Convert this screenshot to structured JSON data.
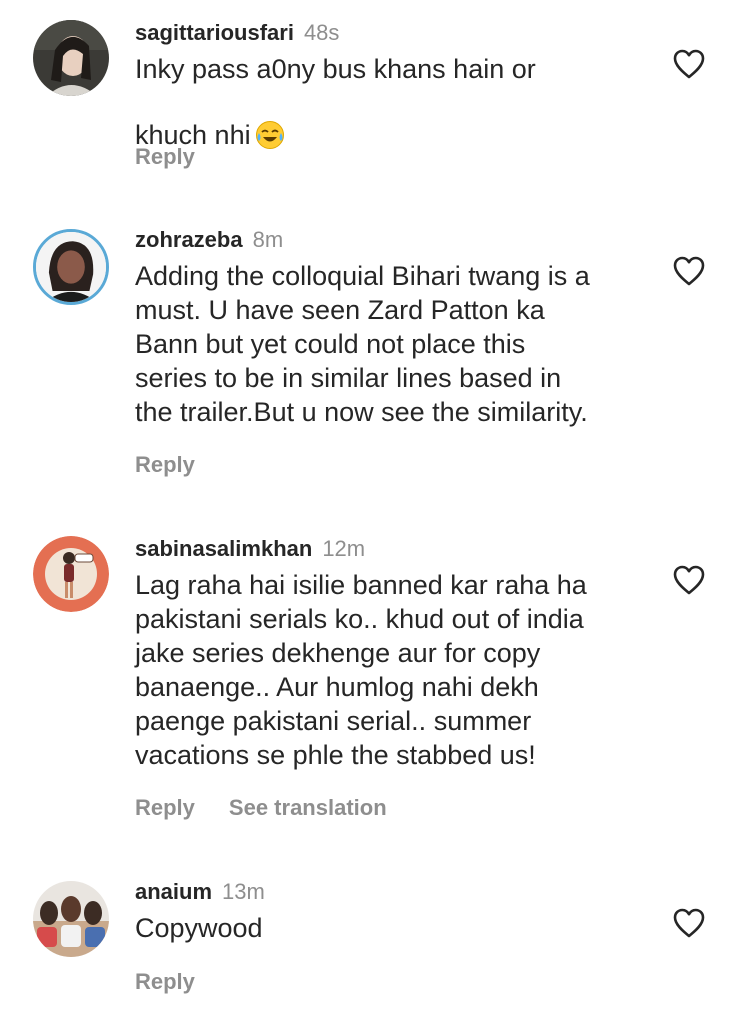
{
  "comments": [
    {
      "username": "sagittariousfari",
      "time": "48s",
      "text": "Inky pass a0ny bus khans hain or\nkhuch nhi",
      "emoji": "😂",
      "reply_label": "Reply"
    },
    {
      "username": "zohrazeba",
      "time": "8m",
      "text": "Adding the colloquial Bihari twang is a\nmust. U have seen Zard Patton ka\nBann but yet could not place this\nseries to be in similar lines based in\nthe trailer.But u now see the similarity.",
      "reply_label": "Reply"
    },
    {
      "username": "sabinasalimkhan",
      "time": "12m",
      "text": "Lag raha hai isilie banned kar raha ha\npakistani serials ko.. khud out of india\njake series dekhenge aur for copy\nbanaenge.. Aur humlog nahi dekh\npaenge pakistani serial.. summer\nvacations se phle the stabbed us!",
      "reply_label": "Reply",
      "translation_label": "See translation"
    },
    {
      "username": "anaium",
      "time": "13m",
      "text": "Copywood",
      "reply_label": "Reply"
    }
  ],
  "icons": {
    "like": "heart-outline-icon",
    "emoji": "face-with-tears-of-joy-icon"
  },
  "colors": {
    "text": "#262626",
    "secondary": "#8e8e8e",
    "background": "#ffffff"
  }
}
